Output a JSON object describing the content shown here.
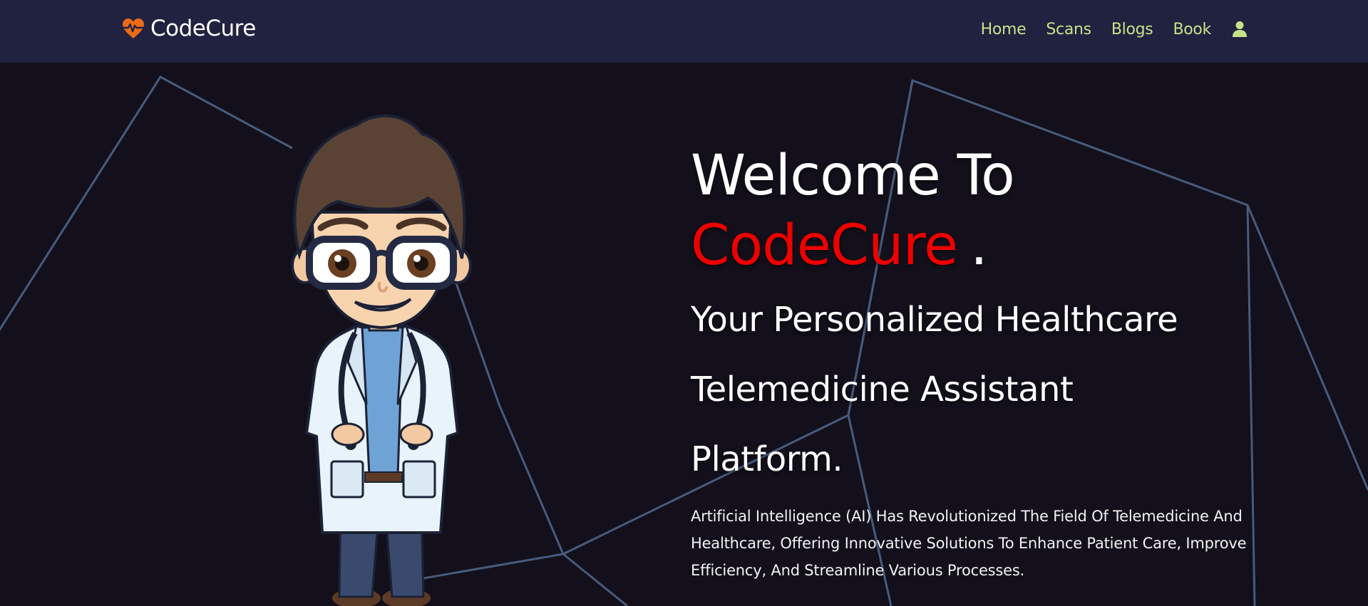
{
  "brand": {
    "name": "CodeCure",
    "logo_icon": "heart-pulse-icon",
    "logo_color": "#ea6b16"
  },
  "nav": {
    "items": [
      {
        "label": "Home"
      },
      {
        "label": "Scans"
      },
      {
        "label": "Blogs"
      },
      {
        "label": "Book"
      }
    ],
    "user_icon": "user-icon",
    "link_color": "#c8e28a",
    "background": "#212240"
  },
  "hero": {
    "welcome_prefix": "Welcome To",
    "brand_highlight": "CodeCure",
    "brand_highlight_color": "#ee0000",
    "punctuation": ".",
    "tagline": "Your Personalized Healthcare Telemedicine Assistant Platform.",
    "description": "Artificial Intelligence (AI) Has Revolutionized The Field Of Telemedicine And Healthcare, Offering Innovative Solutions To Enhance Patient Care, Improve Efficiency, And Streamline Various Processes.",
    "illustration": "cartoon-doctor-illustration",
    "background": "#13101b"
  }
}
